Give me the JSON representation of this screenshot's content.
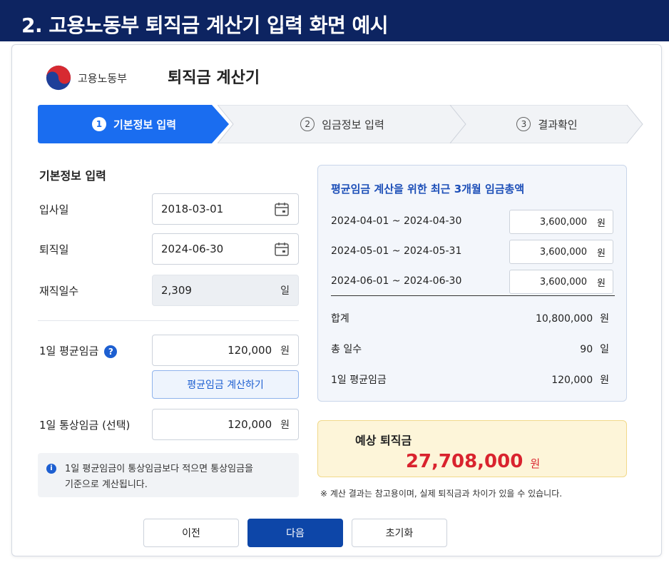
{
  "page_title": "2. 고용노동부 퇴직금 계산기 입력 화면 예시",
  "header": {
    "org_name": "고용노동부",
    "app_title": "퇴직금 계산기"
  },
  "steps": [
    {
      "num": "1",
      "label": "기본정보 입력",
      "active": true
    },
    {
      "num": "2",
      "label": "임금정보 입력",
      "active": false
    },
    {
      "num": "3",
      "label": "결과확인",
      "active": false
    }
  ],
  "basic": {
    "section_title": "기본정보 입력",
    "hire_date": {
      "label": "입사일",
      "value": "2018-03-01"
    },
    "retire_date": {
      "label": "퇴직일",
      "value": "2024-06-30"
    },
    "tenure_days": {
      "label": "재직일수",
      "value": "2,309",
      "unit": "일"
    },
    "avg_wage": {
      "label": "1일 평균임금",
      "value": "120,000",
      "unit": "원"
    },
    "calc_button": "평균임금 계산하기",
    "ordinary_wage": {
      "label": "1일 통상임금 (선택)",
      "value": "120,000",
      "unit": "원"
    },
    "notice": "1일 평균임금이 통상임금보다 적으면 통상임금을 기준으로 계산됩니다.",
    "notice_line1": "1일 평균임금이 통상임금보다 적으면 통상임금을",
    "notice_line2": "기준으로 계산됩니다."
  },
  "wage_panel": {
    "title": "평균임금 계산을 위한 최근 3개월 임금총액",
    "rows": [
      {
        "period": "2024-04-01 ~ 2024-04-30",
        "amount": "3,600,000",
        "unit": "원"
      },
      {
        "period": "2024-05-01 ~ 2024-05-31",
        "amount": "3,600,000",
        "unit": "원"
      },
      {
        "period": "2024-06-01 ~ 2024-06-30",
        "amount": "3,600,000",
        "unit": "원"
      }
    ],
    "sum": {
      "label": "합계",
      "value": "10,800,000",
      "unit": "원"
    },
    "total_days": {
      "label": "총 일수",
      "value": "90",
      "unit": "일"
    },
    "daily_avg": {
      "label": "1일 평균임금",
      "value": "120,000",
      "unit": "원"
    }
  },
  "result": {
    "label": "예상 퇴직금",
    "value": "27,708,000",
    "unit": "원"
  },
  "disclaimer": "※ 계산 결과는 참고용이며, 실제 퇴직금과 차이가 있을 수 있습니다.",
  "buttons": {
    "prev": "이전",
    "next": "다음",
    "reset": "초기화"
  },
  "colors": {
    "title_bar": "#0d2461",
    "active_step": "#1a6df0",
    "primary_button": "#0d46a8",
    "result_amount": "#d9232e",
    "result_bg": "#fdf5d9"
  }
}
